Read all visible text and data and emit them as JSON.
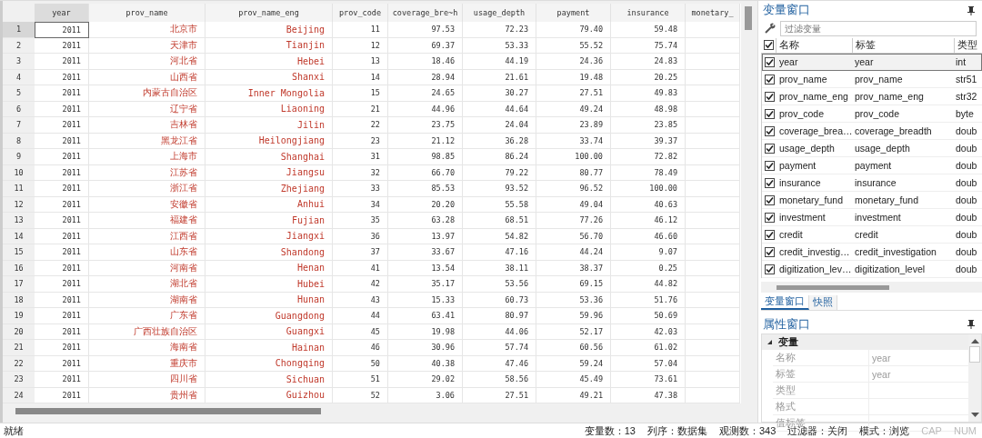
{
  "grid": {
    "columns": [
      {
        "label": "year",
        "kind": "numeric",
        "selected": true
      },
      {
        "label": "prov_name",
        "kind": "string",
        "selected": false
      },
      {
        "label": "prov_name_eng",
        "kind": "string",
        "selected": false
      },
      {
        "label": "prov_code",
        "kind": "numeric",
        "selected": false
      },
      {
        "label": "coverage_bre~h",
        "kind": "numeric",
        "selected": false
      },
      {
        "label": "usage_depth",
        "kind": "numeric",
        "selected": false
      },
      {
        "label": "payment",
        "kind": "numeric",
        "selected": false
      },
      {
        "label": "insurance",
        "kind": "numeric",
        "selected": false
      },
      {
        "label": "monetary_",
        "kind": "numeric",
        "selected": false
      }
    ],
    "rows": [
      {
        "number": "1",
        "selected": true,
        "cells": [
          "2011",
          "北京市",
          "Beijing",
          "11",
          "97.53",
          "72.23",
          "79.40",
          "59.48"
        ]
      },
      {
        "number": "2",
        "selected": false,
        "cells": [
          "2011",
          "天津市",
          "Tianjin",
          "12",
          "69.37",
          "53.33",
          "55.52",
          "75.74"
        ]
      },
      {
        "number": "3",
        "selected": false,
        "cells": [
          "2011",
          "河北省",
          "Hebei",
          "13",
          "18.46",
          "44.19",
          "24.36",
          "24.83"
        ]
      },
      {
        "number": "4",
        "selected": false,
        "cells": [
          "2011",
          "山西省",
          "Shanxi",
          "14",
          "28.94",
          "21.61",
          "19.48",
          "20.25"
        ]
      },
      {
        "number": "5",
        "selected": false,
        "cells": [
          "2011",
          "内蒙古自治区",
          "Inner Mongolia",
          "15",
          "24.65",
          "30.27",
          "27.51",
          "49.83"
        ]
      },
      {
        "number": "6",
        "selected": false,
        "cells": [
          "2011",
          "辽宁省",
          "Liaoning",
          "21",
          "44.96",
          "44.64",
          "49.24",
          "48.98"
        ]
      },
      {
        "number": "7",
        "selected": false,
        "cells": [
          "2011",
          "吉林省",
          "Jilin",
          "22",
          "23.75",
          "24.04",
          "23.89",
          "23.85"
        ]
      },
      {
        "number": "8",
        "selected": false,
        "cells": [
          "2011",
          "黑龙江省",
          "Heilongjiang",
          "23",
          "21.12",
          "36.28",
          "33.74",
          "39.37"
        ]
      },
      {
        "number": "9",
        "selected": false,
        "cells": [
          "2011",
          "上海市",
          "Shanghai",
          "31",
          "98.85",
          "86.24",
          "100.00",
          "72.82"
        ]
      },
      {
        "number": "10",
        "selected": false,
        "cells": [
          "2011",
          "江苏省",
          "Jiangsu",
          "32",
          "66.70",
          "79.22",
          "80.77",
          "78.49"
        ]
      },
      {
        "number": "11",
        "selected": false,
        "cells": [
          "2011",
          "浙江省",
          "Zhejiang",
          "33",
          "85.53",
          "93.52",
          "96.52",
          "100.00"
        ]
      },
      {
        "number": "12",
        "selected": false,
        "cells": [
          "2011",
          "安徽省",
          "Anhui",
          "34",
          "20.20",
          "55.58",
          "49.04",
          "40.63"
        ]
      },
      {
        "number": "13",
        "selected": false,
        "cells": [
          "2011",
          "福建省",
          "Fujian",
          "35",
          "63.28",
          "68.51",
          "77.26",
          "46.12"
        ]
      },
      {
        "number": "14",
        "selected": false,
        "cells": [
          "2011",
          "江西省",
          "Jiangxi",
          "36",
          "13.97",
          "54.82",
          "56.70",
          "46.60"
        ]
      },
      {
        "number": "15",
        "selected": false,
        "cells": [
          "2011",
          "山东省",
          "Shandong",
          "37",
          "33.67",
          "47.16",
          "44.24",
          "9.07"
        ]
      },
      {
        "number": "16",
        "selected": false,
        "cells": [
          "2011",
          "河南省",
          "Henan",
          "41",
          "13.54",
          "38.11",
          "38.37",
          "0.25"
        ]
      },
      {
        "number": "17",
        "selected": false,
        "cells": [
          "2011",
          "湖北省",
          "Hubei",
          "42",
          "35.17",
          "53.56",
          "69.15",
          "44.82"
        ]
      },
      {
        "number": "18",
        "selected": false,
        "cells": [
          "2011",
          "湖南省",
          "Hunan",
          "43",
          "15.33",
          "60.73",
          "53.36",
          "51.76"
        ]
      },
      {
        "number": "19",
        "selected": false,
        "cells": [
          "2011",
          "广东省",
          "Guangdong",
          "44",
          "63.41",
          "80.97",
          "59.96",
          "50.69"
        ]
      },
      {
        "number": "20",
        "selected": false,
        "cells": [
          "2011",
          "广西壮族自治区",
          "Guangxi",
          "45",
          "19.98",
          "44.06",
          "52.17",
          "42.03"
        ]
      },
      {
        "number": "21",
        "selected": false,
        "cells": [
          "2011",
          "海南省",
          "Hainan",
          "46",
          "30.96",
          "57.74",
          "60.56",
          "61.02"
        ]
      },
      {
        "number": "22",
        "selected": false,
        "cells": [
          "2011",
          "重庆市",
          "Chongqing",
          "50",
          "40.38",
          "47.46",
          "59.24",
          "57.04"
        ]
      },
      {
        "number": "23",
        "selected": false,
        "cells": [
          "2011",
          "四川省",
          "Sichuan",
          "51",
          "29.02",
          "58.56",
          "45.49",
          "73.61"
        ]
      },
      {
        "number": "24",
        "selected": false,
        "cells": [
          "2011",
          "贵州省",
          "Guizhou",
          "52",
          "3.06",
          "27.51",
          "49.21",
          "47.38"
        ]
      }
    ]
  },
  "variables_window": {
    "title": "变量窗口",
    "filter": {
      "placeholder": "过滤变量"
    },
    "header": {
      "checked": true,
      "columns": [
        "名称",
        "标签",
        "类型"
      ]
    },
    "rows": [
      {
        "checked": true,
        "selected": true,
        "name": "year",
        "label": "year",
        "type": "int"
      },
      {
        "checked": true,
        "selected": false,
        "name": "prov_name",
        "label": "prov_name",
        "type": "str51"
      },
      {
        "checked": true,
        "selected": false,
        "name": "prov_name_eng",
        "label": "prov_name_eng",
        "type": "str32"
      },
      {
        "checked": true,
        "selected": false,
        "name": "prov_code",
        "label": "prov_code",
        "type": "byte"
      },
      {
        "checked": true,
        "selected": false,
        "name": "coverage_brea…",
        "label": "coverage_breadth",
        "type": "doub"
      },
      {
        "checked": true,
        "selected": false,
        "name": "usage_depth",
        "label": "usage_depth",
        "type": "doub"
      },
      {
        "checked": true,
        "selected": false,
        "name": "payment",
        "label": "payment",
        "type": "doub"
      },
      {
        "checked": true,
        "selected": false,
        "name": "insurance",
        "label": "insurance",
        "type": "doub"
      },
      {
        "checked": true,
        "selected": false,
        "name": "monetary_fund",
        "label": "monetary_fund",
        "type": "doub"
      },
      {
        "checked": true,
        "selected": false,
        "name": "investment",
        "label": "investment",
        "type": "doub"
      },
      {
        "checked": true,
        "selected": false,
        "name": "credit",
        "label": "credit",
        "type": "doub"
      },
      {
        "checked": true,
        "selected": false,
        "name": "credit_investig…",
        "label": "credit_investigation",
        "type": "doub"
      },
      {
        "checked": true,
        "selected": false,
        "name": "digitization_lev…",
        "label": "digitization_level",
        "type": "doub"
      }
    ]
  },
  "tabs": [
    {
      "label": "变量窗口",
      "selected": true
    },
    {
      "label": "快照",
      "selected": false
    }
  ],
  "properties_window": {
    "title": "属性窗口",
    "group": {
      "label": "变量",
      "expanded": true
    },
    "rows": [
      {
        "name": "名称",
        "value": "year"
      },
      {
        "name": "标签",
        "value": "year"
      },
      {
        "name": "类型"
      },
      {
        "name": "格式"
      },
      {
        "name": "值标签"
      }
    ]
  },
  "status_bar": {
    "message": "就绪",
    "items": [
      "变量数：13",
      "列序：数据集",
      "观测数：343",
      "过滤器：关闭",
      "模式：浏览"
    ],
    "indicators": [
      {
        "label": "CAP",
        "on": false
      },
      {
        "label": "NUM",
        "on": false
      }
    ]
  }
}
